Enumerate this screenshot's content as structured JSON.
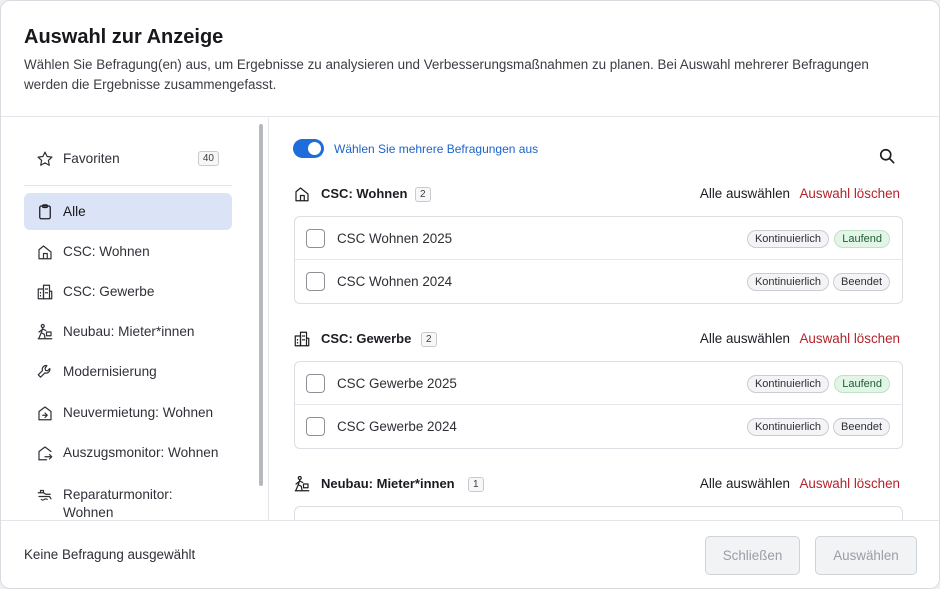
{
  "header": {
    "title": "Auswahl zur Anzeige",
    "subtitle": "Wählen Sie Befragung(en) aus, um Ergebnisse zu analysieren und Verbesserungsmaßnahmen zu planen. Bei Auswahl mehrerer Befragungen werden die Ergebnisse zusammengefasst."
  },
  "sidebar": {
    "favorites": {
      "label": "Favoriten",
      "count": "40",
      "icon": "star-icon"
    },
    "items": [
      {
        "label": "Alle",
        "icon": "clipboard-icon",
        "active": true
      },
      {
        "label": "CSC: Wohnen",
        "icon": "house-icon"
      },
      {
        "label": "CSC: Gewerbe",
        "icon": "buildings-icon"
      },
      {
        "label": "Neubau: Mieter*innen",
        "icon": "mover-icon"
      },
      {
        "label": "Modernisierung",
        "icon": "wrench-icon"
      },
      {
        "label": "Neuvermietung: Wohnen",
        "icon": "house-in-icon"
      },
      {
        "label": "Auszugsmonitor: Wohnen",
        "icon": "house-out-icon"
      },
      {
        "label": "Reparaturmonitor:",
        "label2": "Wohnen",
        "icon": "repair-icon"
      }
    ]
  },
  "main": {
    "toggle_label": "Wählen Sie mehrere Befragungen aus",
    "toggle_on": true,
    "select_all": "Alle auswählen",
    "clear_selection": "Auswahl löschen",
    "groups": [
      {
        "title": "CSC: Wohnen",
        "count": "2",
        "icon": "house-icon",
        "rows": [
          {
            "label": "CSC Wohnen 2025",
            "type": "Kontinuierlich",
            "status": "Laufend"
          },
          {
            "label": "CSC Wohnen 2024",
            "type": "Kontinuierlich",
            "status": "Beendet"
          }
        ]
      },
      {
        "title": "CSC: Gewerbe",
        "count": "2",
        "icon": "buildings-icon",
        "rows": [
          {
            "label": "CSC Gewerbe 2025",
            "type": "Kontinuierlich",
            "status": "Laufend"
          },
          {
            "label": "CSC Gewerbe 2024",
            "type": "Kontinuierlich",
            "status": "Beendet"
          }
        ]
      },
      {
        "title": "Neubau: Mieter*innen",
        "count": "1",
        "icon": "mover-icon",
        "rows": []
      }
    ]
  },
  "footer": {
    "status": "Keine Befragung ausgewählt",
    "close_label": "Schließen",
    "select_label": "Auswählen"
  },
  "colors": {
    "accent": "#1e6ddb",
    "danger": "#b4232b",
    "active_bg": "#dbe4f6",
    "running_badge": "#e3f5e7"
  }
}
